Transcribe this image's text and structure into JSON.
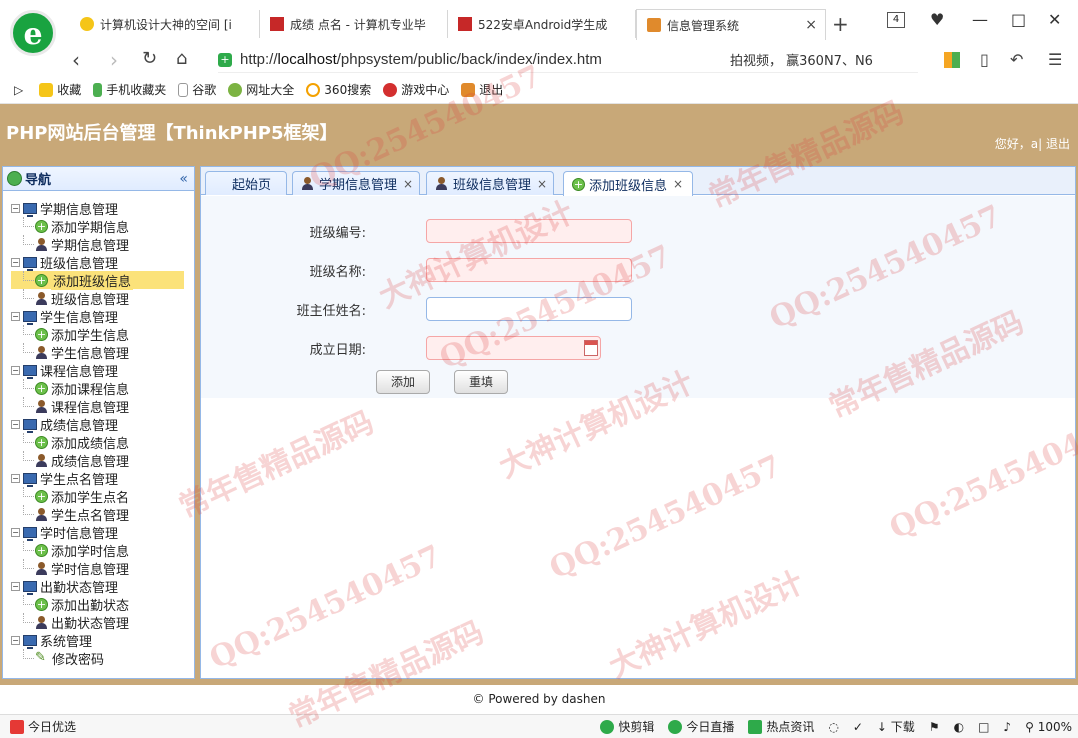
{
  "browser": {
    "tabs": [
      {
        "label": "计算机设计大神的空间 [i",
        "close": ""
      },
      {
        "label": "成绩 点名 - 计算机专业毕",
        "close": ""
      },
      {
        "label": "522安卓Android学生成",
        "close": ""
      },
      {
        "label": "信息管理系统",
        "close": "×"
      }
    ],
    "tab_count": "4",
    "url_prefix": "http://",
    "url_host": "localhost",
    "url_path": "/phpsystem/public/back/index/index.htm",
    "search_suggestion": "拍视频， 赢360N7、N6",
    "favorites": [
      {
        "label": "收藏",
        "icon": "star-icon"
      },
      {
        "label": "手机收藏夹",
        "icon": "phone-icon"
      },
      {
        "label": "谷歌",
        "icon": "page-icon"
      },
      {
        "label": "网址大全",
        "icon": "globe-icon"
      },
      {
        "label": "360搜索",
        "icon": "search-icon"
      },
      {
        "label": "游戏中心",
        "icon": "game-icon"
      },
      {
        "label": "退出",
        "icon": "exit-icon"
      }
    ]
  },
  "header": {
    "title": "PHP网站后台管理【ThinkPHP5框架】",
    "greeting": "您好，a|",
    "logout": "退出"
  },
  "sidebar": {
    "title": "导航",
    "groups": [
      {
        "label": "学期信息管理",
        "items": [
          {
            "label": "添加学期信息",
            "icon": "add-icon"
          },
          {
            "label": "学期信息管理",
            "icon": "user-icon"
          }
        ]
      },
      {
        "label": "班级信息管理",
        "items": [
          {
            "label": "添加班级信息",
            "icon": "add-icon"
          },
          {
            "label": "班级信息管理",
            "icon": "user-icon"
          }
        ]
      },
      {
        "label": "学生信息管理",
        "items": [
          {
            "label": "添加学生信息",
            "icon": "add-icon"
          },
          {
            "label": "学生信息管理",
            "icon": "user-icon"
          }
        ]
      },
      {
        "label": "课程信息管理",
        "items": [
          {
            "label": "添加课程信息",
            "icon": "add-icon"
          },
          {
            "label": "课程信息管理",
            "icon": "user-icon"
          }
        ]
      },
      {
        "label": "成绩信息管理",
        "items": [
          {
            "label": "添加成绩信息",
            "icon": "add-icon"
          },
          {
            "label": "成绩信息管理",
            "icon": "user-icon"
          }
        ]
      },
      {
        "label": "学生点名管理",
        "items": [
          {
            "label": "添加学生点名",
            "icon": "add-icon"
          },
          {
            "label": "学生点名管理",
            "icon": "user-icon"
          }
        ]
      },
      {
        "label": "学时信息管理",
        "items": [
          {
            "label": "添加学时信息",
            "icon": "add-icon"
          },
          {
            "label": "学时信息管理",
            "icon": "user-icon"
          }
        ]
      },
      {
        "label": "出勤状态管理",
        "items": [
          {
            "label": "添加出勤状态",
            "icon": "add-icon"
          },
          {
            "label": "出勤状态管理",
            "icon": "user-icon"
          }
        ]
      },
      {
        "label": "系统管理",
        "items": [
          {
            "label": "修改密码",
            "icon": "pencil-icon"
          }
        ]
      }
    ]
  },
  "tabs": [
    {
      "label": "起始页",
      "closable": false
    },
    {
      "label": "学期信息管理",
      "closable": true,
      "close": "×"
    },
    {
      "label": "班级信息管理",
      "closable": true,
      "close": "×"
    },
    {
      "label": "添加班级信息",
      "closable": true,
      "close": "×"
    }
  ],
  "form": {
    "class_no_label": "班级编号:",
    "class_name_label": "班级名称:",
    "teacher_label": "班主任姓名:",
    "date_label": "成立日期:",
    "class_no_value": "",
    "class_name_value": "",
    "teacher_value": "",
    "date_value": "",
    "submit": "添加",
    "reset": "重填"
  },
  "footer": {
    "text": "© Powered by dashen"
  },
  "statusbar": {
    "left": "今日优选",
    "items": [
      "快剪辑",
      "今日直播",
      "热点资讯"
    ],
    "download": "下载",
    "zoom": "100%"
  },
  "watermarks": [
    "QQ:254540457",
    "常年售精品源码",
    "大神计算机设计"
  ],
  "colors": {
    "header_bg": "#c8a878",
    "panel_border": "#95b8e7",
    "selected": "#fbe27a",
    "invalid_bg": "#ffeeee"
  }
}
